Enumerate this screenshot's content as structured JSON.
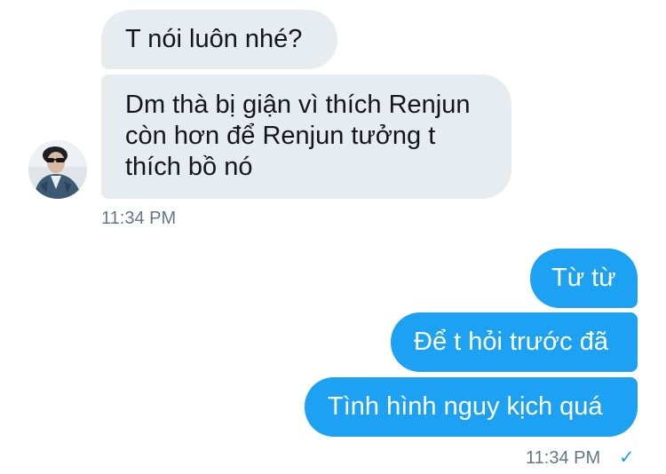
{
  "incoming": {
    "messages": [
      {
        "text": "T nói luôn nhé?"
      },
      {
        "text": "Dm thà bị giận vì thích Renjun\ncòn hơn để Renjun tưởng t\nthích bồ nó"
      }
    ],
    "timestamp": "11:34 PM",
    "avatar_icon": "user-avatar-photo"
  },
  "outgoing": {
    "messages": [
      {
        "text": "Từ từ"
      },
      {
        "text": "Để t hỏi trước đã"
      },
      {
        "text": "Tình hình nguy kịch quá"
      }
    ],
    "timestamp": "11:34 PM",
    "status_icon": "✓"
  },
  "colors": {
    "incoming_bubble": "#e6ecf0",
    "outgoing_bubble": "#1da1f2",
    "timestamp": "#657786"
  }
}
